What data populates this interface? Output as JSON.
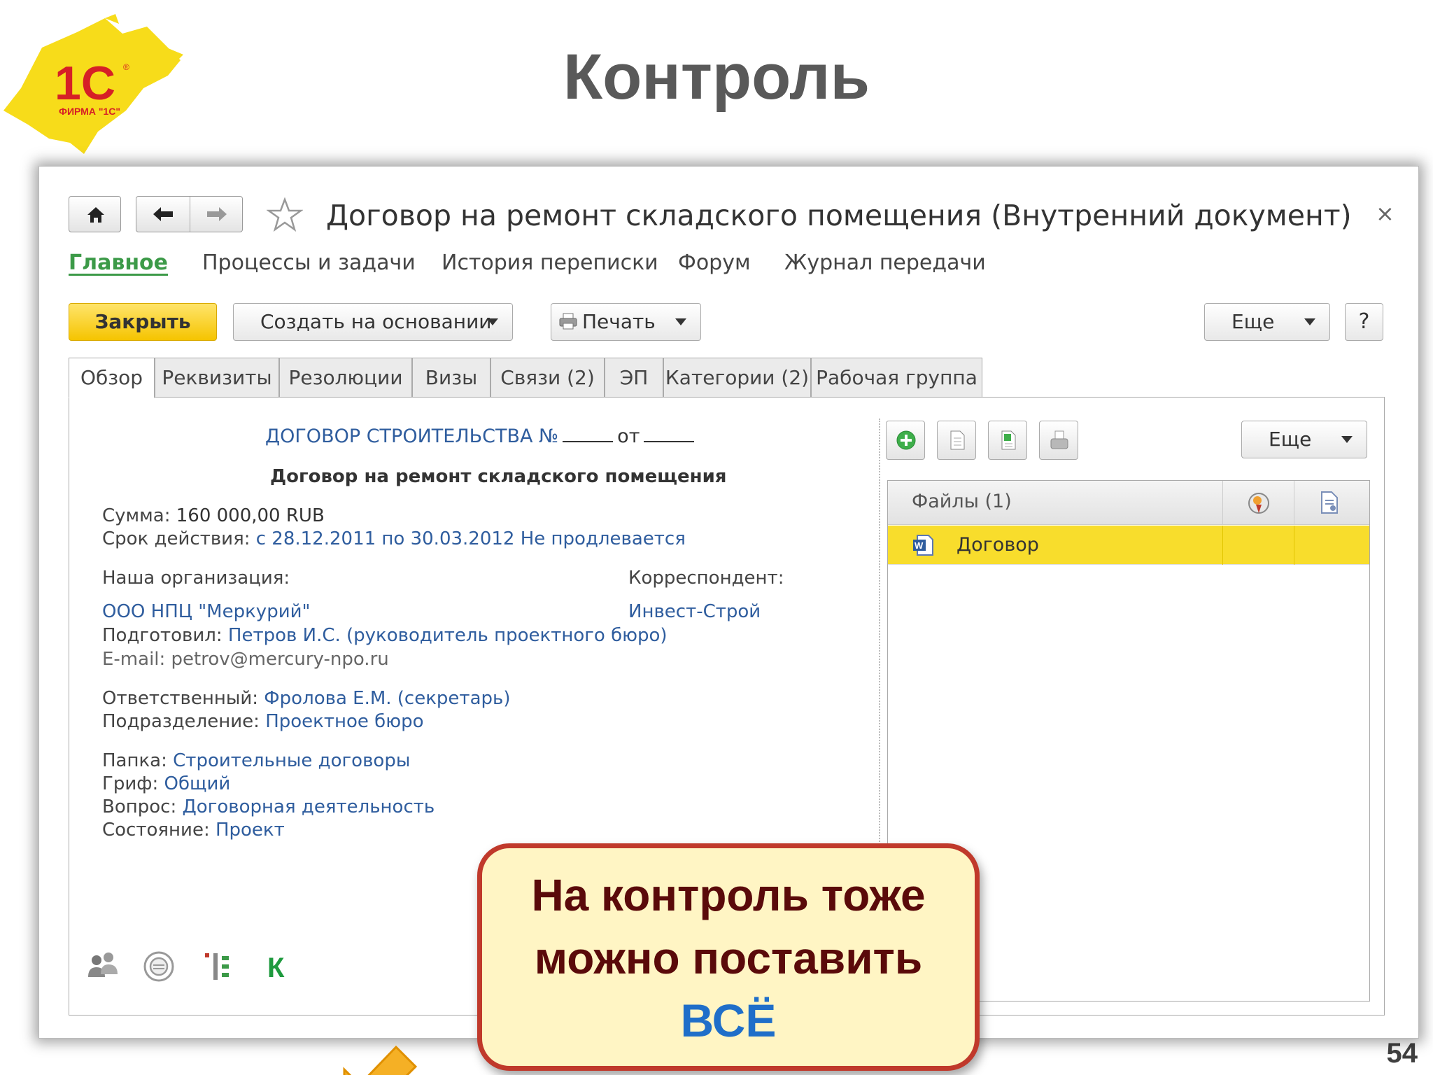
{
  "slide": {
    "title": "Контроль",
    "page_number": "54",
    "logo_text_main": "1С",
    "logo_text_sub": "ФИРМА \"1С\""
  },
  "window": {
    "document_title": "Договор на ремонт складского помещения (Внутренний документ)",
    "close_symbol": "×"
  },
  "menu": {
    "main": "Главное",
    "processes": "Процессы и задачи",
    "history": "История переписки",
    "forum": "Форум",
    "journal": "Журнал передачи"
  },
  "toolbar": {
    "close_label": "Закрыть",
    "create_label": "Создать на основании",
    "print_label": "Печать",
    "more_label": "Еще",
    "help_label": "?"
  },
  "tabs": [
    {
      "label": "Обзор"
    },
    {
      "label": "Реквизиты"
    },
    {
      "label": "Резолюции"
    },
    {
      "label": "Визы"
    },
    {
      "label": "Связи (2)"
    },
    {
      "label": "ЭП"
    },
    {
      "label": "Категории (2)"
    },
    {
      "label": "Рабочая группа"
    }
  ],
  "document": {
    "heading_prefix": "ДОГОВОР СТРОИТЕЛЬСТВА №",
    "heading_from": "от",
    "subheading": "Договор на ремонт складского помещения",
    "sum_label": "Сумма:",
    "sum_value": "160 000,00 RUB",
    "term_label": "Срок действия:",
    "term_value": "с 28.12.2011 по 30.03.2012 Не продлевается",
    "our_org_label": "Наша организация:",
    "our_org_value": "ООО НПЦ \"Меркурий\"",
    "prepared_label": "Подготовил:",
    "prepared_value": "Петров И.С. (руководитель проектного бюро)",
    "email_label": "E-mail:",
    "email_value": "petrov@mercury-npo.ru",
    "correspondent_label": "Корреспондент:",
    "correspondent_value": "Инвест-Строй",
    "responsible_label": "Ответственный:",
    "responsible_value": "Фролова Е.М. (секретарь)",
    "department_label": "Подразделение:",
    "department_value": "Проектное бюро",
    "folder_label": "Папка:",
    "folder_value": "Строительные договоры",
    "stamp_label": "Гриф:",
    "stamp_value": "Общий",
    "question_label": "Вопрос:",
    "question_value": "Договорная деятельность",
    "state_label": "Состояние:",
    "state_value": "Проект"
  },
  "bottom_icons": {
    "control_label": "К"
  },
  "files": {
    "more_label": "Еще",
    "header_label": "Файлы (1)",
    "rows": [
      {
        "name": "Договор"
      }
    ]
  },
  "callout": {
    "line1": "На контроль тоже",
    "line2": "можно поставить",
    "line3": "ВСЁ"
  },
  "colors": {
    "accent_yellow": "#f5c400",
    "link_blue": "#2f5d9e",
    "menu_green": "#3c9a48",
    "callout_border": "#c0392b",
    "callout_text": "#5a0a0a",
    "callout_highlight": "#1f6ec9",
    "selected_row": "#f8dd2c"
  }
}
